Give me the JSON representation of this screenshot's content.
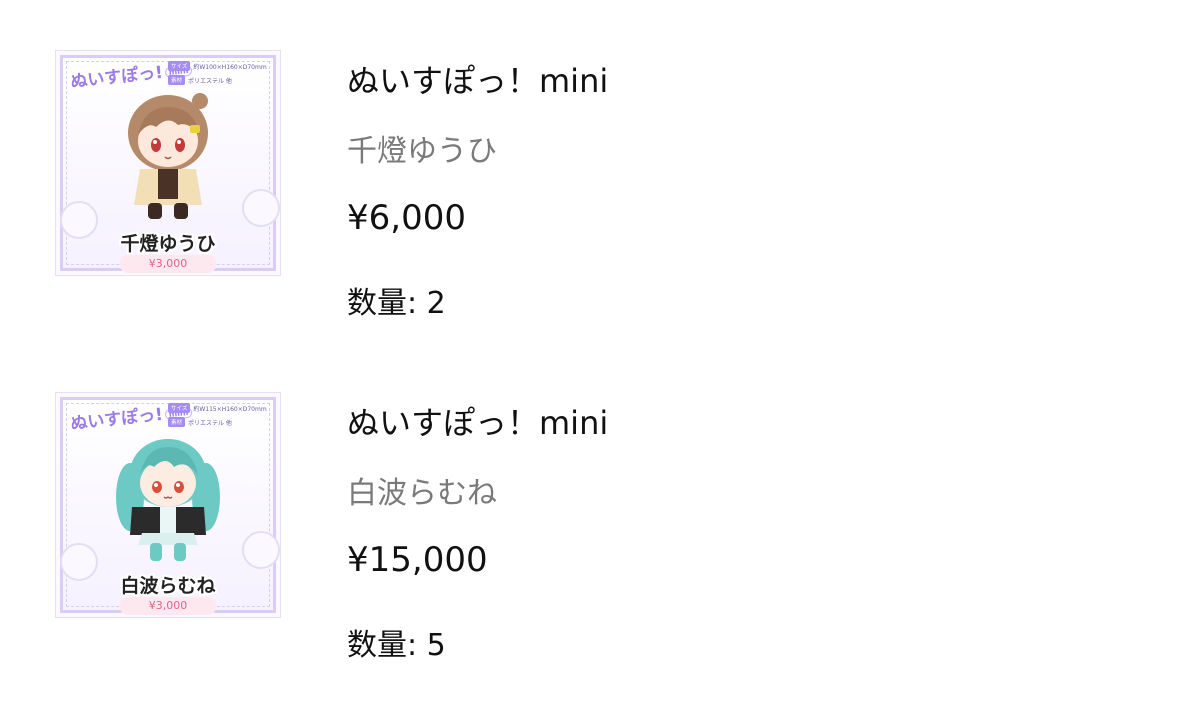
{
  "cart": {
    "items": [
      {
        "title": "ぬいすぽっ！mini",
        "variant": "千燈ゆうひ",
        "price": "¥6,000",
        "quantity_label": "数量:",
        "quantity": "2",
        "thumbnail": {
          "logo": "ぬいすぽっ!",
          "logo_sub": "mini",
          "size_tag": "サイズ",
          "size_value": "約W100×H160×D70mm",
          "material_tag": "素材",
          "material_value": "ポリエステル 他",
          "name": "千燈ゆうひ",
          "unit_price": "¥3,000",
          "hair_color": "#b48a6a",
          "outfit_color": "#f3dfb6"
        }
      },
      {
        "title": "ぬいすぽっ！mini",
        "variant": "白波らむね",
        "price": "¥15,000",
        "quantity_label": "数量:",
        "quantity": "5",
        "thumbnail": {
          "logo": "ぬいすぽっ!",
          "logo_sub": "mini",
          "size_tag": "サイズ",
          "size_value": "約W115×H160×D70mm",
          "material_tag": "素材",
          "material_value": "ポリエステル 他",
          "name": "白波らむね",
          "unit_price": "¥3,000",
          "hair_color": "#6cc9c4",
          "outfit_color": "#2b2b2b"
        }
      }
    ]
  }
}
